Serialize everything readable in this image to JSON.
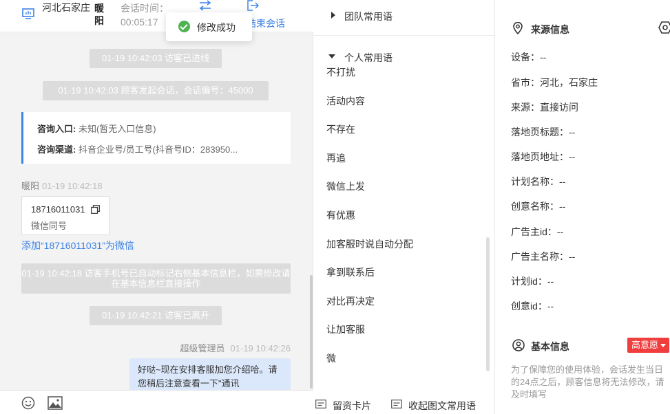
{
  "chat": {
    "header": {
      "location": "河北石家庄",
      "visitor_name": "暖阳",
      "session_time_label": "会话时间：",
      "session_time_value": "00:05:17",
      "end_label": "结束会话"
    },
    "toast": "修改成功",
    "messages": {
      "sys1": "01-19 10:42:03 访客已进线",
      "sys2": "01-19 10:42:03 顾客发起会话，会话编号：45000",
      "entry_label": "咨询入口:",
      "entry_value": "未知(暂无入口信息)",
      "channel_label": "咨询渠道:",
      "channel_value": "抖音企业号/员工号(抖音号ID：283950...",
      "visitor_sender": "暖阳",
      "visitor_time": "01-19 10:42:18",
      "phone": "18716011031",
      "phone_sub": "微信同号",
      "add_wechat": "添加“18716011031”为微信",
      "sys3": "01-19 10:42:18 访客手机号已自动标记右侧基本信息栏，如需修改请在基本信息栏直接操作",
      "sys4": "01-19 10:42:21 访客已离开",
      "agent_name": "超级管理员",
      "agent_time": "01-19 10:42:26",
      "agent_text": "好哒~现在安排客服加您介绍哈。请您稍后注意查看一下\"通讯"
    },
    "footer": {
      "emoji_icon": "emoji-icon",
      "image_icon": "image-icon"
    }
  },
  "phrases": {
    "team_label": "团队常用语",
    "personal_label": "个人常用语",
    "items": [
      "不打扰",
      "活动内容",
      "不存在",
      "再追",
      "微信上发",
      "有优惠",
      "加客服时说自动分配",
      "拿到联系后",
      "对比再决定",
      "让加客服",
      "微"
    ],
    "card_label": "留资卡片",
    "fold_label": "收起图文常用语"
  },
  "info": {
    "source_title": "来源信息",
    "fields": [
      "设备：--",
      "省市：河北，石家庄",
      "来源：直接访问",
      "落地页标题：--",
      "落地页地址：--",
      "计划名称：--",
      "创意名称：--",
      "广告主id：--",
      "广告主名称：--",
      "计划id：--",
      "创意id：--"
    ],
    "basic_title": "基本信息",
    "badge": "高意愿",
    "note": "为了保障您的使用体验，会话发生当日的24点之后，顾客信息将无法修改，请及时填写"
  },
  "colors": {
    "accent": "#3b82e6",
    "badge": "#f03e3e",
    "success": "#4cb34f"
  }
}
